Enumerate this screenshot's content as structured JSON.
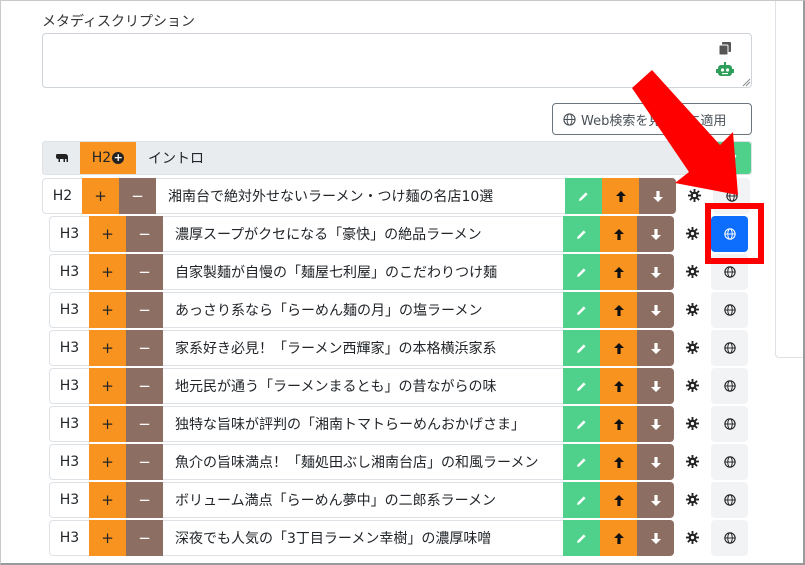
{
  "meta": {
    "label": "メタディスクリプション",
    "value": "",
    "placeholder": ""
  },
  "toolbar": {
    "web_apply_label": "Web検索を見出しに適用"
  },
  "intro": {
    "level_add_label": "H2",
    "title": "イントロ"
  },
  "colors": {
    "orange": "#f7931e",
    "brown": "#8d6e63",
    "green": "#4fd18b",
    "active_blue": "#0d6efd",
    "annotation_red": "#ff0000"
  },
  "headings": [
    {
      "level": "H2",
      "plus": "+",
      "minus": "−",
      "title": "湘南台で絶対外せないラーメン・つけ麺の名店10選",
      "active": false
    },
    {
      "level": "H3",
      "plus": "+",
      "minus": "−",
      "title": "濃厚スープがクセになる「豪快」の絶品ラーメン",
      "active": true
    },
    {
      "level": "H3",
      "plus": "+",
      "minus": "−",
      "title": "自家製麺が自慢の「麺屋七利屋」のこだわりつけ麺",
      "active": false
    },
    {
      "level": "H3",
      "plus": "+",
      "minus": "−",
      "title": "あっさり系なら「らーめん麺の月」の塩ラーメン",
      "active": false
    },
    {
      "level": "H3",
      "plus": "+",
      "minus": "−",
      "title": "家系好き必見！「ラーメン西輝家」の本格横浜家系",
      "active": false
    },
    {
      "level": "H3",
      "plus": "+",
      "minus": "−",
      "title": "地元民が通う「ラーメンまるとも」の昔ながらの味",
      "active": false
    },
    {
      "level": "H3",
      "plus": "+",
      "minus": "−",
      "title": "独特な旨味が評判の「湘南トマトらーめんおかげさま」",
      "active": false
    },
    {
      "level": "H3",
      "plus": "+",
      "minus": "−",
      "title": "魚介の旨味満点！「麺処田ぶし湘南台店」の和風ラーメン",
      "active": false
    },
    {
      "level": "H3",
      "plus": "+",
      "minus": "−",
      "title": "ボリューム満点「らーめん夢中」の二郎系ラーメン",
      "active": false
    },
    {
      "level": "H3",
      "plus": "+",
      "minus": "−",
      "title": "深夜でも人気の「3丁目ラーメン幸樹」の濃厚味噌",
      "active": false
    }
  ]
}
